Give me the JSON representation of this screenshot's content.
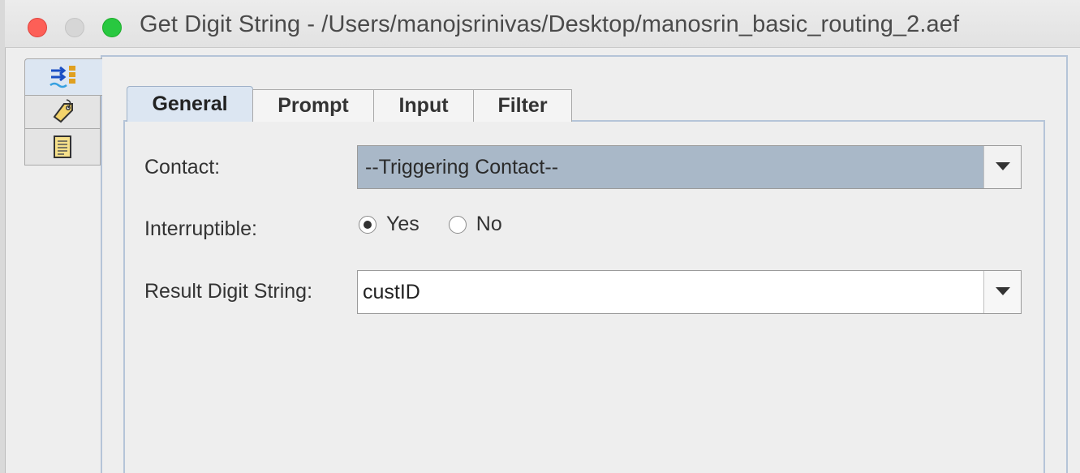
{
  "window": {
    "title": "Get Digit String - /Users/manojsrinivas/Desktop/manosrin_basic_routing_2.aef"
  },
  "side_tabs": [
    {
      "icon": "arrows-flow-icon",
      "active": true
    },
    {
      "icon": "tag-icon",
      "active": false
    },
    {
      "icon": "notepad-icon",
      "active": false
    }
  ],
  "tabs": [
    {
      "label": "General",
      "active": true
    },
    {
      "label": "Prompt",
      "active": false
    },
    {
      "label": "Input",
      "active": false
    },
    {
      "label": "Filter",
      "active": false
    }
  ],
  "form": {
    "contact": {
      "label": "Contact:",
      "value": "--Triggering Contact--"
    },
    "interruptible": {
      "label": "Interruptible:",
      "options": [
        {
          "label": "Yes",
          "selected": true
        },
        {
          "label": "No",
          "selected": false
        }
      ]
    },
    "result": {
      "label": "Result Digit String:",
      "value": "custID"
    }
  },
  "colors": {
    "active_tab": "#dce6f2",
    "selected_combo": "#a9b8c8",
    "frame_border": "#b5c4d8"
  }
}
